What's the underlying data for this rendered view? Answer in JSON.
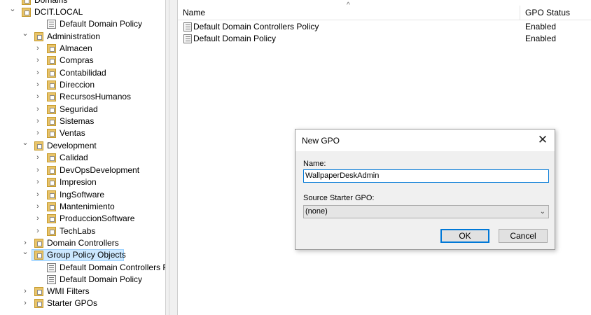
{
  "tree": {
    "items": [
      {
        "label": "Domains",
        "chevron": "",
        "icon": "domain-icon"
      },
      {
        "label": "DCIT.LOCAL",
        "chevron": "⌄",
        "icon": "domain-icon"
      },
      {
        "label": "Default Domain Policy",
        "chevron": "",
        "icon": "gpo-link-icon"
      },
      {
        "label": "Administration",
        "chevron": "⌄",
        "icon": "ou-folder-icon"
      },
      {
        "label": "Almacen",
        "chevron": "›",
        "icon": "ou-folder-icon"
      },
      {
        "label": "Compras",
        "chevron": "›",
        "icon": "ou-folder-icon"
      },
      {
        "label": "Contabilidad",
        "chevron": "›",
        "icon": "ou-folder-icon"
      },
      {
        "label": "Direccion",
        "chevron": "›",
        "icon": "ou-folder-icon"
      },
      {
        "label": "RecursosHumanos",
        "chevron": "›",
        "icon": "ou-folder-icon"
      },
      {
        "label": "Seguridad",
        "chevron": "›",
        "icon": "ou-folder-icon"
      },
      {
        "label": "Sistemas",
        "chevron": "›",
        "icon": "ou-folder-icon"
      },
      {
        "label": "Ventas",
        "chevron": "›",
        "icon": "ou-folder-icon"
      },
      {
        "label": "Development",
        "chevron": "⌄",
        "icon": "ou-folder-icon"
      },
      {
        "label": "Calidad",
        "chevron": "›",
        "icon": "ou-folder-icon"
      },
      {
        "label": "DevOpsDevelopment",
        "chevron": "›",
        "icon": "ou-folder-icon"
      },
      {
        "label": "Impresion",
        "chevron": "›",
        "icon": "ou-folder-icon"
      },
      {
        "label": "IngSoftware",
        "chevron": "›",
        "icon": "ou-folder-icon"
      },
      {
        "label": "Mantenimiento",
        "chevron": "›",
        "icon": "ou-folder-icon"
      },
      {
        "label": "ProduccionSoftware",
        "chevron": "›",
        "icon": "ou-folder-icon"
      },
      {
        "label": "TechLabs",
        "chevron": "›",
        "icon": "ou-folder-icon"
      },
      {
        "label": "Domain Controllers",
        "chevron": "›",
        "icon": "ou-folder-icon"
      },
      {
        "label": "Group Policy Objects",
        "chevron": "⌄",
        "icon": "gpo-folder-icon"
      },
      {
        "label": "Default Domain Controllers P",
        "chevron": "",
        "icon": "gpo-icon"
      },
      {
        "label": "Default Domain Policy",
        "chevron": "",
        "icon": "gpo-icon"
      },
      {
        "label": "WMI Filters",
        "chevron": "›",
        "icon": "wmi-folder-icon"
      },
      {
        "label": "Starter GPOs",
        "chevron": "›",
        "icon": "starter-folder-icon"
      }
    ]
  },
  "list": {
    "sort_arrow": "^",
    "columns": {
      "name": "Name",
      "status": "GPO Status"
    },
    "rows": [
      {
        "name": "Default Domain Controllers Policy",
        "status": "Enabled"
      },
      {
        "name": "Default Domain Policy",
        "status": "Enabled"
      }
    ]
  },
  "dialog": {
    "title": "New GPO",
    "close_glyph": "✕",
    "name_label": "Name:",
    "name_value": "WallpaperDeskAdmin",
    "source_label": "Source Starter GPO:",
    "source_value": "(none)",
    "source_chevron": "⌄",
    "ok_label": "OK",
    "cancel_label": "Cancel"
  },
  "colors": {
    "selection": "#cce8ff",
    "focus": "#0078d7",
    "folder": "#e9c46a"
  }
}
